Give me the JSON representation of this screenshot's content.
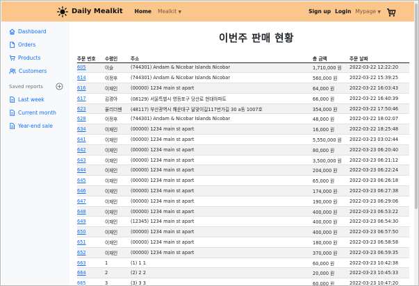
{
  "navbar": {
    "brand": "Daily Mealkit",
    "home": "Home",
    "mealkit": "Mealkit",
    "signup": "Sign up",
    "login": "Login",
    "mypage": "Mypage",
    "brand_color": "#fbc68c"
  },
  "sidebar": {
    "items": [
      {
        "label": "Dashboard",
        "icon": "home-icon"
      },
      {
        "label": "Orders",
        "icon": "file-icon"
      },
      {
        "label": "Products",
        "icon": "cart-icon"
      },
      {
        "label": "Customers",
        "icon": "users-icon"
      }
    ],
    "saved_reports_label": "Saved reports",
    "reports": [
      {
        "label": "Last week",
        "icon": "file-text-icon"
      },
      {
        "label": "Current month",
        "icon": "file-text-icon"
      },
      {
        "label": "Year-end sale",
        "icon": "file-text-icon"
      }
    ]
  },
  "main": {
    "title": "이번주 판매 현황",
    "columns": [
      "주문 번호",
      "수령인",
      "주소",
      "총 금액",
      "주문 날짜"
    ],
    "rows": [
      [
        "605",
        "이슬",
        "(744301) Andam & Nicobar Islands Nicobar",
        "1,710,000 원",
        "2022-03-22 12:22:20"
      ],
      [
        "614",
        "이정후",
        "(744301) Andam & Nicobar Islands Nicobar",
        "560,000 원",
        "2022-03-22 15:39:25"
      ],
      [
        "616",
        "이재인",
        "(00000) 1234 main st apart",
        "64,000 원",
        "2022-03-22 16:03:43"
      ],
      [
        "617",
        "김경아",
        "(08129) 서울특별시 영등포구 당산로 현대아파트",
        "66,000 원",
        "2022-03-22 16:40:39"
      ],
      [
        "623",
        "율리더쎈",
        "(48117) 부산광역시 해운대구 달맞이길117번가길 30 a동 1007호",
        "354,000 원",
        "2022-03-22 17:50:46"
      ],
      [
        "628",
        "이정후",
        "(744301) Andam & Nicobar Islands Nicobar",
        "48,000 원",
        "2022-03-22 18:02:07"
      ],
      [
        "634",
        "이재인",
        "(00000) 1234 main st apart",
        "16,000 원",
        "2022-03-22 18:25:48"
      ],
      [
        "641",
        "이재인",
        "(00000) 1234 main st apart",
        "5,550,000 원",
        "2022-03-23 03:02:44"
      ],
      [
        "642",
        "이재인",
        "(00000) 1234 main st apart",
        "80,000 원",
        "2022-03-23 06:20:40"
      ],
      [
        "643",
        "이재인",
        "(00000) 1234 main st apart",
        "3,500,000 원",
        "2022-03-23 06:21:12"
      ],
      [
        "644",
        "이재인",
        "(00000) 1234 main st apart",
        "204,000 원",
        "2022-03-23 06:22:24"
      ],
      [
        "645",
        "이재인",
        "(00000) 1234 main st apart",
        "65,000 원",
        "2022-03-23 06:26:18"
      ],
      [
        "646",
        "이재인",
        "(00000) 1234 main st apart",
        "174,000 원",
        "2022-03-23 06:27:38"
      ],
      [
        "647",
        "이재인",
        "(00000) 1234 main st apart",
        "190,000 원",
        "2022-03-23 06:29:06"
      ],
      [
        "648",
        "이재인",
        "(00000) 1234 main st apart",
        "400,000 원",
        "2022-03-23 06:53:22"
      ],
      [
        "649",
        "이재인",
        "(12345) 1234 main st apart",
        "400,000 원",
        "2022-03-23 06:54:30"
      ],
      [
        "650",
        "이재인",
        "(00000) 1234 main st apart",
        "400,000 원",
        "2022-03-23 06:57:50"
      ],
      [
        "651",
        "이재인",
        "(00000) 1234 main st apart",
        "180,000 원",
        "2022-03-23 06:58:58"
      ],
      [
        "652",
        "이재인",
        "(00000) 1234 main st apart",
        "370,000 원",
        "2022-03-23 06:59:35"
      ],
      [
        "663",
        "1",
        "(1) 1 1",
        "60,000 원",
        "2022-03-23 10:42:38"
      ],
      [
        "664",
        "2",
        "(2) 2 2",
        "20,000 원",
        "2022-03-23 10:45:33"
      ],
      [
        "665",
        "3",
        "(3) 3 3",
        "60,000 원",
        "2022-03-23 10:47:20"
      ]
    ]
  }
}
